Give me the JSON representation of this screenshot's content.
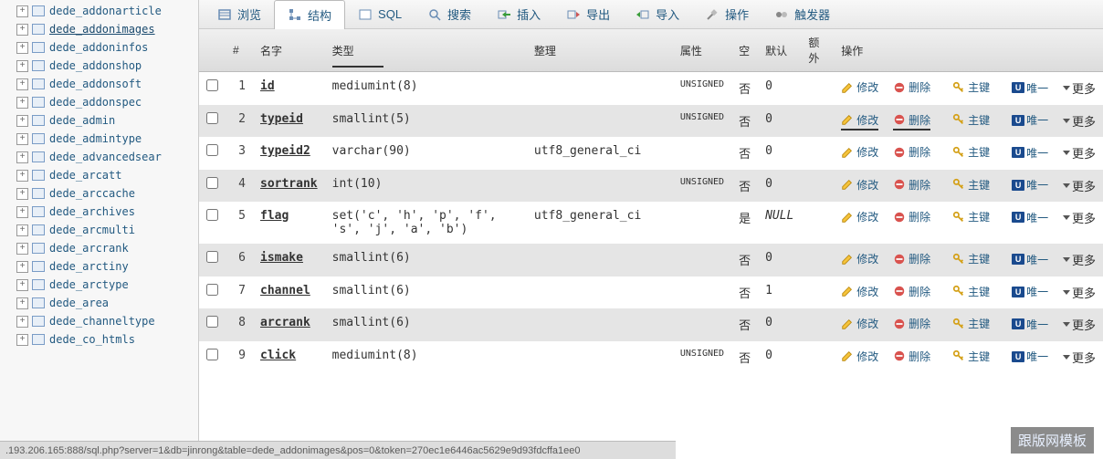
{
  "sidebar": {
    "items": [
      {
        "label": "dede_addonarticle",
        "active": false
      },
      {
        "label": "dede_addonimages",
        "active": true
      },
      {
        "label": "dede_addoninfos",
        "active": false
      },
      {
        "label": "dede_addonshop",
        "active": false
      },
      {
        "label": "dede_addonsoft",
        "active": false
      },
      {
        "label": "dede_addonspec",
        "active": false
      },
      {
        "label": "dede_admin",
        "active": false
      },
      {
        "label": "dede_admintype",
        "active": false
      },
      {
        "label": "dede_advancedsear",
        "active": false
      },
      {
        "label": "dede_arcatt",
        "active": false
      },
      {
        "label": "dede_arccache",
        "active": false
      },
      {
        "label": "dede_archives",
        "active": false
      },
      {
        "label": "dede_arcmulti",
        "active": false
      },
      {
        "label": "dede_arcrank",
        "active": false
      },
      {
        "label": "dede_arctiny",
        "active": false
      },
      {
        "label": "dede_arctype",
        "active": false
      },
      {
        "label": "dede_area",
        "active": false
      },
      {
        "label": "dede_channeltype",
        "active": false
      },
      {
        "label": "dede_co_htmls",
        "active": false
      }
    ]
  },
  "tabs": [
    {
      "label": "浏览",
      "icon": "browse"
    },
    {
      "label": "结构",
      "icon": "structure",
      "active": true
    },
    {
      "label": "SQL",
      "icon": "sql"
    },
    {
      "label": "搜索",
      "icon": "search"
    },
    {
      "label": "插入",
      "icon": "insert"
    },
    {
      "label": "导出",
      "icon": "export"
    },
    {
      "label": "导入",
      "icon": "import"
    },
    {
      "label": "操作",
      "icon": "operations"
    },
    {
      "label": "触发器",
      "icon": "triggers"
    }
  ],
  "headers": {
    "num": "#",
    "name": "名字",
    "type": "类型",
    "collation": "整理",
    "attr": "属性",
    "null": "空",
    "default": "默认",
    "extra": "额外",
    "action": "操作"
  },
  "rows": [
    {
      "n": "1",
      "name": "id",
      "type": "mediumint(8)",
      "coll": "",
      "attr": "UNSIGNED",
      "nul": "否",
      "def": "0",
      "sel": false
    },
    {
      "n": "2",
      "name": "typeid",
      "type": "smallint(5)",
      "coll": "",
      "attr": "UNSIGNED",
      "nul": "否",
      "def": "0",
      "sel": true
    },
    {
      "n": "3",
      "name": "typeid2",
      "type": "varchar(90)",
      "coll": "utf8_general_ci",
      "attr": "",
      "nul": "否",
      "def": "0",
      "sel": false
    },
    {
      "n": "4",
      "name": "sortrank",
      "type": "int(10)",
      "coll": "",
      "attr": "UNSIGNED",
      "nul": "否",
      "def": "0",
      "sel": false
    },
    {
      "n": "5",
      "name": "flag",
      "type": "set('c', 'h', 'p', 'f', 's', 'j', 'a', 'b')",
      "coll": "utf8_general_ci",
      "attr": "",
      "nul": "是",
      "def": "NULL",
      "sel": false
    },
    {
      "n": "6",
      "name": "ismake",
      "type": "smallint(6)",
      "coll": "",
      "attr": "",
      "nul": "否",
      "def": "0",
      "sel": false
    },
    {
      "n": "7",
      "name": "channel",
      "type": "smallint(6)",
      "coll": "",
      "attr": "",
      "nul": "否",
      "def": "1",
      "sel": false
    },
    {
      "n": "8",
      "name": "arcrank",
      "type": "smallint(6)",
      "coll": "",
      "attr": "",
      "nul": "否",
      "def": "0",
      "sel": false
    },
    {
      "n": "9",
      "name": "click",
      "type": "mediumint(8)",
      "coll": "",
      "attr": "UNSIGNED",
      "nul": "否",
      "def": "0",
      "sel": false
    }
  ],
  "actions": {
    "edit": "修改",
    "delete": "删除",
    "primary": "主键",
    "unique": "唯一",
    "more": "更多"
  },
  "statusbar": ".193.206.165:888/sql.php?server=1&db=jinrong&table=dede_addonimages&pos=0&token=270ec1e6446ac5629e9d93fdcffa1ee0",
  "watermark": "跟版网模板"
}
